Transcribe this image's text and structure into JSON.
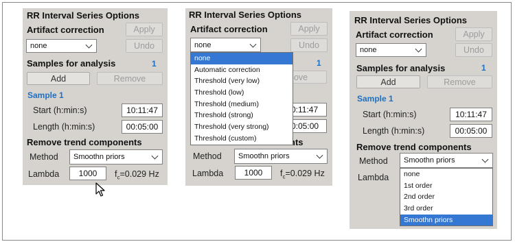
{
  "panel1": {
    "title": "RR Interval Series Options",
    "artifact_label": "Artifact correction",
    "apply": "Apply",
    "undo": "Undo",
    "artifact_value": "none",
    "samples_label": "Samples for analysis",
    "samples_count": "1",
    "add": "Add",
    "remove": "Remove",
    "sample_title": "Sample 1",
    "start_label": "Start (h:min:s)",
    "start_value": "10:11:47",
    "length_label": "Length (h:min:s)",
    "length_value": "00:05:00",
    "trend_label": "Remove trend components",
    "method_label": "Method",
    "method_value": "Smoothn priors",
    "lambda_label": "Lambda",
    "lambda_value": "1000",
    "fc_sym": "f",
    "fc_sub": "c",
    "fc_val": "=0.029 Hz"
  },
  "panel2": {
    "title": "RR Interval Series Options",
    "artifact_label": "Artifact correction",
    "apply": "Apply",
    "undo": "Undo",
    "artifact_value": "none",
    "samples_count": "1",
    "remove_partial": "nove",
    "start_partial": "0:11:47",
    "length_partial": "0:05:00",
    "trend_partial": "nts",
    "method_label": "Method",
    "method_value": "Smoothn priors",
    "lambda_label": "Lambda",
    "lambda_value": "1000",
    "fc_sym": "f",
    "fc_sub": "c",
    "fc_val": "=0.029 Hz",
    "dropdown_options": [
      "none",
      "Automatic correction",
      "Threshold (very low)",
      "Threshold (low)",
      "Threshold (medium)",
      "Threshold (strong)",
      "Threshold (very strong)",
      "Threshold (custom)"
    ],
    "dropdown_selected_index": 0
  },
  "panel3": {
    "title": "RR Interval Series Options",
    "artifact_label": "Artifact correction",
    "apply": "Apply",
    "undo": "Undo",
    "artifact_value": "none",
    "samples_label": "Samples for analysis",
    "samples_count": "1",
    "add": "Add",
    "remove": "Remove",
    "sample_title": "Sample 1",
    "start_label": "Start (h:min:s)",
    "start_value": "10:11:47",
    "length_label": "Length (h:min:s)",
    "length_value": "00:05:00",
    "trend_label": "Remove trend components",
    "method_label": "Method",
    "method_value": "Smoothn priors",
    "lambda_label": "Lambda",
    "dropdown_options": [
      "none",
      "1st order",
      "2nd order",
      "3rd order",
      "Smoothn priors"
    ],
    "dropdown_selected_index": 4
  },
  "colors": {
    "panel_bg": "#d6d3ce",
    "accent_blue": "#1d6fc4",
    "selection": "#3478d4"
  },
  "icons": {
    "combo": "chevron-down-icon",
    "pointer": "mouse-cursor-icon"
  }
}
